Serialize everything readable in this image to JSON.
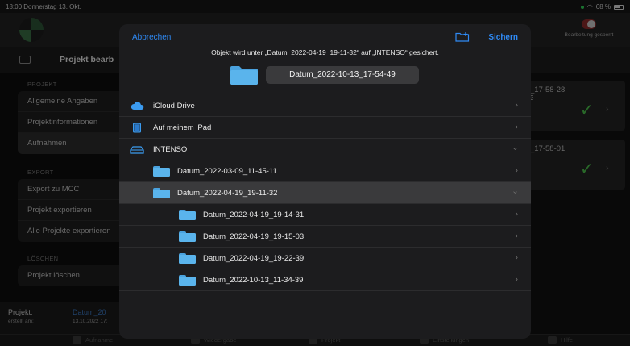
{
  "status": {
    "time_date": "18:00  Donnerstag 13. Okt.",
    "battery": "68 %"
  },
  "app": {
    "edit_lock_label": "Bearbeitung gesperrt",
    "sidebar_title": "Projekt bearb",
    "sections": {
      "projekt": "PROJEKT",
      "export": "EXPORT",
      "loeschen": "LÖSCHEN"
    },
    "projekt_items": [
      "Allgemeine Angaben",
      "Projektinformationen",
      "Aufnahmen"
    ],
    "export_items": [
      "Export zu MCC",
      "Projekt exportieren",
      "Alle Projekte exportieren"
    ],
    "delete_items": [
      "Projekt löschen"
    ],
    "footer": {
      "project_label": "Projekt:",
      "project_value": "Datum_20",
      "created_label": "erstellt am:",
      "created_value": "13.10.2022 17:"
    },
    "records": [
      {
        "time": "_17-58-28",
        "sub": "3"
      },
      {
        "time": "_17-58-01"
      }
    ],
    "tabs": [
      "Aufnahme",
      "Wiedergabe",
      "Projekt",
      "Einstellungen",
      "Hilfe"
    ]
  },
  "dialog": {
    "cancel_label": "Abbrechen",
    "save_label": "Sichern",
    "info_text": "Objekt wird unter „Datum_2022-04-19_19-11-32“ auf „INTENSO“ gesichert.",
    "filename": "Datum_2022-10-13_17-54-49",
    "locations": [
      {
        "label": "iCloud Drive",
        "icon": "icloud-icon"
      },
      {
        "label": "Auf meinem iPad",
        "icon": "ipad-icon"
      },
      {
        "label": "INTENSO",
        "icon": "drive-icon",
        "expanded": true
      }
    ],
    "folders_level1": [
      {
        "label": "Datum_2022-03-09_11-45-11"
      },
      {
        "label": "Datum_2022-04-19_19-11-32",
        "selected": true,
        "expanded": true
      }
    ],
    "folders_level2": [
      {
        "label": "Datum_2022-04-19_19-14-31"
      },
      {
        "label": "Datum_2022-04-19_19-15-03"
      },
      {
        "label": "Datum_2022-04-19_19-22-39"
      },
      {
        "label": "Datum_2022-10-13_11-34-39"
      }
    ]
  },
  "colors": {
    "accent": "#2f8af5",
    "folder": "#5ab4ec",
    "check": "#4cc24c",
    "sheet_bg": "#1c1c1e"
  }
}
